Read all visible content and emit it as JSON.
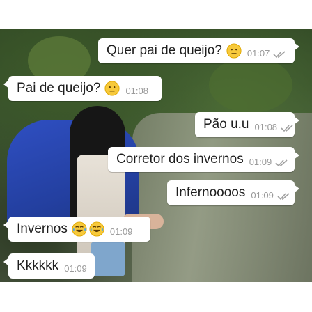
{
  "messages": [
    {
      "text": "Quer pai de queijo?",
      "time": "01:07",
      "emoji": "neutral-face-icon",
      "direction": "outgoing",
      "status": "read"
    },
    {
      "text": "Pai de queijo?",
      "time": "01:08",
      "emoji": "neutral-face-icon",
      "direction": "incoming"
    },
    {
      "text": "Pão u.u",
      "time": "01:08",
      "direction": "outgoing",
      "status": "read"
    },
    {
      "text": "Corretor dos invernos",
      "time": "01:09",
      "direction": "outgoing",
      "status": "read"
    },
    {
      "text": "Infernoooos",
      "time": "01:09",
      "direction": "outgoing",
      "status": "read"
    },
    {
      "text": "Invernos",
      "time": "01:09",
      "emoji": "tears-of-joy-icon",
      "emoji_count": 2,
      "direction": "incoming"
    },
    {
      "text": "Kkkkkk",
      "time": "01:09",
      "direction": "incoming"
    }
  ],
  "colors": {
    "bubble": "#ffffff",
    "text": "#1e1e1e",
    "time": "#9a9a9a",
    "ticks": "#a0a0a0",
    "emoji_yellow": "#f7c93b"
  }
}
